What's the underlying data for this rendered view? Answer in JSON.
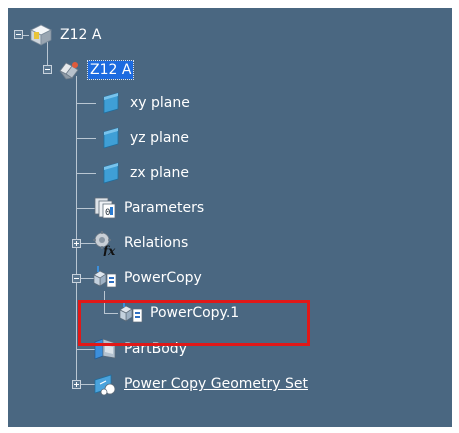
{
  "tree": {
    "root": {
      "label": "Z12 A",
      "icon": "product-icon"
    },
    "part": {
      "label": "Z12 A",
      "icon": "part-icon"
    },
    "xy_plane": {
      "label": "xy plane",
      "icon": "plane-icon"
    },
    "yz_plane": {
      "label": "yz plane",
      "icon": "plane-icon"
    },
    "zx_plane": {
      "label": "zx plane",
      "icon": "plane-icon"
    },
    "parameters": {
      "label": "Parameters",
      "icon": "parameters-icon"
    },
    "relations": {
      "label": "Relations",
      "icon": "relations-fx-icon"
    },
    "powercopy": {
      "label": "PowerCopy",
      "icon": "powercopy-icon"
    },
    "powercopy_1": {
      "label": "PowerCopy.1",
      "icon": "powercopy-icon"
    },
    "partbody": {
      "label": "PartBody",
      "icon": "partbody-icon"
    },
    "geometry_set": {
      "label": "Power Copy Geometry Set",
      "icon": "geometrical-set-icon"
    }
  },
  "colors": {
    "background": "#4a6781",
    "selection": "#1d6be0",
    "highlight_box": "#e01818"
  }
}
